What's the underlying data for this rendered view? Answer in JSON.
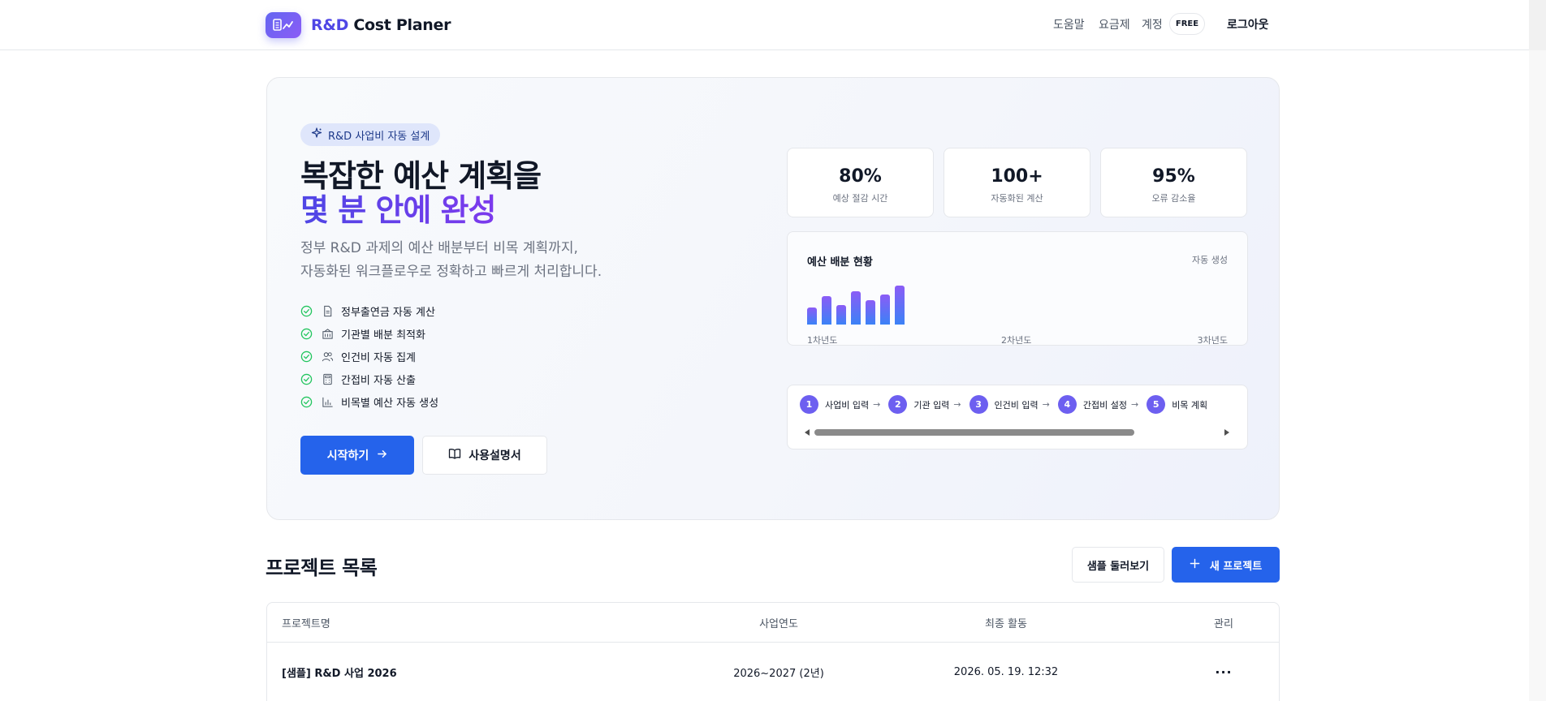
{
  "header": {
    "logo_prefix": "R&D",
    "logo_rest": " Cost Planer",
    "nav_help": "도움말",
    "nav_plan": "요금제",
    "nav_account": "계정",
    "plan_badge": "FREE",
    "logout": "로그아웃"
  },
  "hero": {
    "pill": "R&D 사업비 자동 설계",
    "title_line1": "복잡한 예산 계획을",
    "title_line2": "몇 분 안에 완성",
    "subtitle_line1": "정부 R&D 과제의 예산 배분부터 비목 계획까지,",
    "subtitle_line2": "자동화된 워크플로우로 정확하고 빠르게 처리합니다.",
    "features": [
      {
        "label": "정부출연금 자동 계산",
        "icon": "document-icon"
      },
      {
        "label": "기관별 배분 최적화",
        "icon": "building-icon"
      },
      {
        "label": "인건비 자동 집계",
        "icon": "users-icon"
      },
      {
        "label": "간접비 자동 산출",
        "icon": "calculator-icon"
      },
      {
        "label": "비목별 예산 자동 생성",
        "icon": "bar-chart-icon"
      }
    ],
    "start_button": "시작하기",
    "manual_button": "사용설명서",
    "stats": [
      {
        "value": "80%",
        "label": "예상 절감 시간"
      },
      {
        "value": "100+",
        "label": "자동화된 계산"
      },
      {
        "value": "95%",
        "label": "오류 감소율"
      }
    ],
    "budget": {
      "title": "예산 배분 현황",
      "tag": "자동 생성",
      "bar_levels": [
        0.44,
        0.72,
        0.5,
        0.86,
        0.62,
        0.78,
        1.0
      ],
      "years": [
        "1차년도",
        "2차년도",
        "3차년도"
      ]
    },
    "steps": [
      {
        "num": "1",
        "label": "사업비 입력"
      },
      {
        "num": "2",
        "label": "기관 입력"
      },
      {
        "num": "3",
        "label": "인건비 입력"
      },
      {
        "num": "4",
        "label": "간접비 설정"
      },
      {
        "num": "5",
        "label": "비목 계획"
      }
    ]
  },
  "projects": {
    "title": "프로젝트 목록",
    "sample_button": "샘플 둘러보기",
    "new_button": "새 프로젝트",
    "columns": [
      "프로젝트명",
      "사업연도",
      "최종 활동",
      "관리"
    ],
    "rows": [
      {
        "name": "[샘플] R&D 사업 2026",
        "years": "2026~2027 (2년)",
        "last_activity": "2026. 05. 19. 12:32",
        "action": "···"
      }
    ]
  },
  "colors": {
    "primary": "#2563eb",
    "accent": "#4f46e5",
    "accent2": "#7c3aed",
    "success": "#22c55e"
  }
}
